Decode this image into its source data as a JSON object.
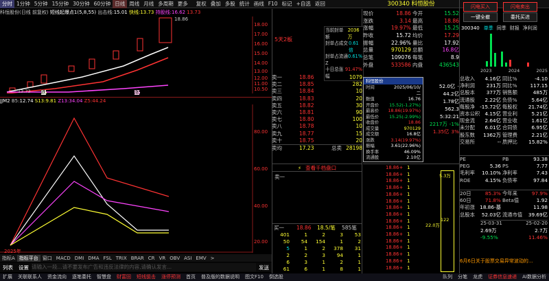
{
  "top_tabs": [
    "分时",
    "1分钟",
    "5分钟",
    "15分钟",
    "30分钟",
    "60分钟",
    "日线",
    "周线",
    "月线",
    "多周期",
    "更多"
  ],
  "top_tools": [
    "复权",
    "叠加",
    "多股",
    "统计",
    "画线",
    "F10",
    "标记",
    "+自选",
    "返回"
  ],
  "chart_title": {
    "name": "科恒股份(日线 前复权)",
    "indicator": "短线起爆点1(5,8,55)",
    "line1_label": "出击线:",
    "line1": "15.01",
    "line2_label": "快线:",
    "line2": "13.73",
    "line3_label": "持股线:",
    "line3": "16.62",
    "line4": "13.73"
  },
  "price_axis": [
    "18.00",
    "17.00",
    "16.00",
    "15.00",
    "14.00",
    "13.00",
    "12.00",
    "11.00",
    "10.50"
  ],
  "price_annot": "18.86",
  "low_annot": "13.73",
  "kline_badge1": "跌",
  "kline_badge2": "涨",
  "sub_title": {
    "name": "JJM2",
    "b5_label": "B5:",
    "b5": "12.74",
    "s13_label": "S13:",
    "s13": "9.81",
    "z13_label": "Z13:",
    "z13": "34.04",
    "z5_label": "Z5:",
    "z5": "44.24"
  },
  "sub_axis": [
    "80.00",
    "60.00",
    "40.00",
    "20.00"
  ],
  "year_label": "2025年",
  "indicator_tabs": [
    "指标A",
    "指标平台",
    "窗口",
    "MACD",
    "DMI",
    "DMA",
    "FSL",
    "TRIX",
    "BRAR",
    "CR",
    "VR",
    "OBV",
    "ASI",
    "EMV",
    ">"
  ],
  "bottom_row": {
    "list": "列表",
    "settings": "设置",
    "marquee": "请输入一段...请不要发布广告和违反法律的内容,请确认发言...",
    "send": "发送"
  },
  "status_bar": [
    "扩展",
    "关联联系人",
    "资金流向",
    "逐笔委托",
    "智慧盘",
    "财富回",
    "短线狙击",
    "涨停预测",
    "首页",
    "普及版的数据说明",
    "图文F10",
    "倒选股"
  ],
  "status_right": [
    "队列",
    "分笔",
    "龙虎",
    "证券信息速递",
    "AI数据分析"
  ],
  "mid_title": "5天2板",
  "seal_info": [
    {
      "k": "当前封单额",
      "v": "2036万"
    },
    {
      "k": "封单占成交",
      "v": "0.61倍"
    },
    {
      "k": "封单占流通Z",
      "v": "0.61%"
    },
    {
      "k": "十日总涨幅",
      "v": "91.47%"
    }
  ],
  "asks": [
    {
      "l": "卖一",
      "p": "18.86",
      "v": "1079"
    },
    {
      "l": "卖二",
      "p": "18.85",
      "v": "282"
    },
    {
      "l": "卖三",
      "p": "18.84",
      "v": "10"
    },
    {
      "l": "卖四",
      "p": "18.83",
      "v": "20"
    },
    {
      "l": "卖五",
      "p": "18.82",
      "v": "30"
    },
    {
      "l": "卖六",
      "p": "18.81",
      "v": "90"
    },
    {
      "l": "卖七",
      "p": "18.80",
      "v": "100"
    },
    {
      "l": "卖八",
      "p": "18.78",
      "v": "10"
    },
    {
      "l": "卖九",
      "p": "18.77",
      "v": "15"
    },
    {
      "l": "卖十",
      "p": "18.75",
      "v": "20"
    }
  ],
  "ask_totals": [
    {
      "k": "卖均",
      "p": "17.23",
      "k2": "总卖",
      "v": "28198"
    }
  ],
  "depth_link": "查看千档盘口",
  "sell1_label": "卖一",
  "buy1": {
    "l": "买一",
    "p": "18.86",
    "v": "18.5/笔",
    "n": "585笔"
  },
  "queue": [
    [
      401,
      1,
      2,
      3,
      53
    ],
    [
      50,
      54,
      154,
      1,
      2
    ],
    [
      5,
      1,
      2,
      378,
      31
    ],
    [
      2,
      2,
      3,
      94,
      1
    ],
    [
      6,
      3,
      1,
      2,
      1
    ],
    [
      61,
      6,
      1,
      8,
      1
    ]
  ],
  "stock_code": "300340",
  "stock_name": "科恒股份",
  "quote": [
    {
      "a": "现价",
      "b": "18.86",
      "c": "今开",
      "d": "15.52"
    },
    {
      "a": "涨跌",
      "b": "3.14",
      "c": "最高",
      "d": "18.86"
    },
    {
      "a": "涨幅",
      "b": "19.97%",
      "c": "最低",
      "d": "15.25"
    },
    {
      "a": "昨收",
      "b": "15.72",
      "c": "均价",
      "d": "17.29"
    },
    {
      "a": "振幅",
      "b": "22.96%",
      "c": "量比",
      "d": "17.92"
    },
    {
      "a": "总量",
      "b": "970129",
      "c": "总额",
      "d": "16.8亿"
    },
    {
      "a": "总笔",
      "b": "109076",
      "c": "每笔",
      "d": "8.9"
    },
    {
      "a": "外盘",
      "b": "533586",
      "c": "内盘",
      "d": "436543"
    }
  ],
  "popup": {
    "title": "科恒股份",
    "rows": [
      {
        "k": "时间",
        "v": "2025/06/10/二"
      },
      {
        "k": "数值",
        "v": "16.76"
      },
      {
        "k": "开盘价",
        "v": "15.52(-1.27%)"
      },
      {
        "k": "最高价",
        "v": "18.86(19.97%)"
      },
      {
        "k": "最低价",
        "v": "15.25(-2.99%)"
      },
      {
        "k": "收盘价",
        "v": "18.86"
      },
      {
        "k": "成交量",
        "v": "970129"
      },
      {
        "k": "成交额",
        "v": "16.8亿"
      },
      {
        "k": "涨跌",
        "v": "3.14(19.97%)"
      },
      {
        "k": "振幅",
        "v": "3.61(22.96%)"
      },
      {
        "k": "换手率",
        "v": "46.09%"
      },
      {
        "k": "流通股",
        "v": "2.10亿"
      }
    ]
  },
  "quote_side": [
    {
      "a": "52.0亿",
      "b": "-"
    },
    {
      "a": "44.2亿",
      "b": ""
    },
    {
      "a": "1.78亿",
      "b": ""
    },
    {
      "a": "562.3",
      "b": ""
    },
    {
      "a": "5:32:21",
      "b": ""
    },
    {
      "a": "2217万",
      "b": "-1%"
    },
    {
      "a": "1.35亿",
      "b": "3%"
    }
  ],
  "tick_list": [
    {
      "t": "18.86+",
      "v": "1"
    },
    {
      "t": "18.86+",
      "v": "1"
    },
    {
      "t": "18.86+",
      "v": "1"
    },
    {
      "t": "18.86+",
      "v": "1"
    },
    {
      "t": "18.86+",
      "v": "1"
    },
    {
      "t": "18.86+",
      "v": "1"
    },
    {
      "t": "18.86+",
      "v": "1"
    },
    {
      "t": "18.86+",
      "v": "1"
    },
    {
      "t": "18.86+",
      "v": "1"
    },
    {
      "t": "18.86+",
      "v": "1"
    },
    {
      "t": "18.86+",
      "v": "1"
    },
    {
      "t": "18.86+",
      "v": "1"
    },
    {
      "t": "18.86+",
      "v": "1"
    },
    {
      "t": "18.86+",
      "v": "1"
    },
    {
      "t": "18.86+",
      "v": "1"
    },
    {
      "t": "18.86+",
      "v": "1"
    }
  ],
  "vol_bar": {
    "v1": "5.3万",
    "v2": "122",
    "v3": "22.0万"
  },
  "right_buttons": [
    "闪电买入",
    "闪电卖出",
    "一键全撤",
    "委托买进"
  ],
  "right_header": {
    "code": "300340",
    "tabs": [
      "单季",
      "同季",
      "财报",
      "净利润"
    ]
  },
  "right_years": [
    "2023",
    "2024",
    "2025"
  ],
  "fin": [
    {
      "a": "总收入",
      "b": "4.16亿",
      "c": "同比%",
      "d": "-4.10"
    },
    {
      "a": "净利润",
      "b": "231万",
      "c": "同比%",
      "d": "117.15"
    },
    {
      "a": "总股本",
      "b": "377万",
      "c": "销售额",
      "d": "485万"
    },
    {
      "a": "流通股",
      "b": "2.22亿",
      "c": "负债%",
      "d": "5.64亿"
    },
    {
      "a": "每股净",
      "b": "-15.72亿",
      "c": "每股权",
      "d": "21.74亿"
    },
    {
      "a": "资本公积",
      "b": "4.15亿",
      "c": "营业利",
      "d": "5.21亿"
    },
    {
      "a": "现金流",
      "b": "2.64亿",
      "c": "营业收",
      "d": "1.61亿"
    },
    {
      "a": "未分配",
      "b": "6.01亿",
      "c": "合同债",
      "d": "6.95亿"
    },
    {
      "a": "股东数",
      "b": "1362万",
      "c": "管理费",
      "d": "2.21亿"
    },
    {
      "a": "交易所",
      "b": "--",
      "c": "质押比",
      "d": "15.82%"
    }
  ],
  "fin2": [
    {
      "a": "PE",
      "b": "",
      "c": "PB",
      "d": "93.38"
    },
    {
      "a": "PEG",
      "b": "5.36",
      "c": "PS",
      "d": "7.77"
    },
    {
      "a": "毛利率",
      "b": "10.10%",
      "c": "净利率",
      "d": "7.43"
    },
    {
      "a": "ROE",
      "b": "4.15%",
      "c": "负债率",
      "d": "97.84"
    }
  ],
  "fin3": [
    {
      "a": "20日",
      "b": "85.3%",
      "c": "今年来",
      "d": "97.9%"
    },
    {
      "a": "60日",
      "b": "71.8%",
      "c": "Beta值",
      "d": "1.92"
    },
    {
      "a": "年初涨",
      "b": "18.86-基",
      "c": "",
      "d": "11.98"
    },
    {
      "a": "总股本",
      "b": "52.03亿",
      "c": "流通市值",
      "d": "39.69亿"
    }
  ],
  "dates": {
    "a": "25-03-31",
    "b": "25-02-20"
  },
  "fin4": [
    {
      "a": "2.69万",
      "b": "2.7万"
    },
    {
      "a": "-9.55%",
      "b": "11.46%"
    }
  ],
  "news": "6月6日关于股票交易异常波动的..."
}
